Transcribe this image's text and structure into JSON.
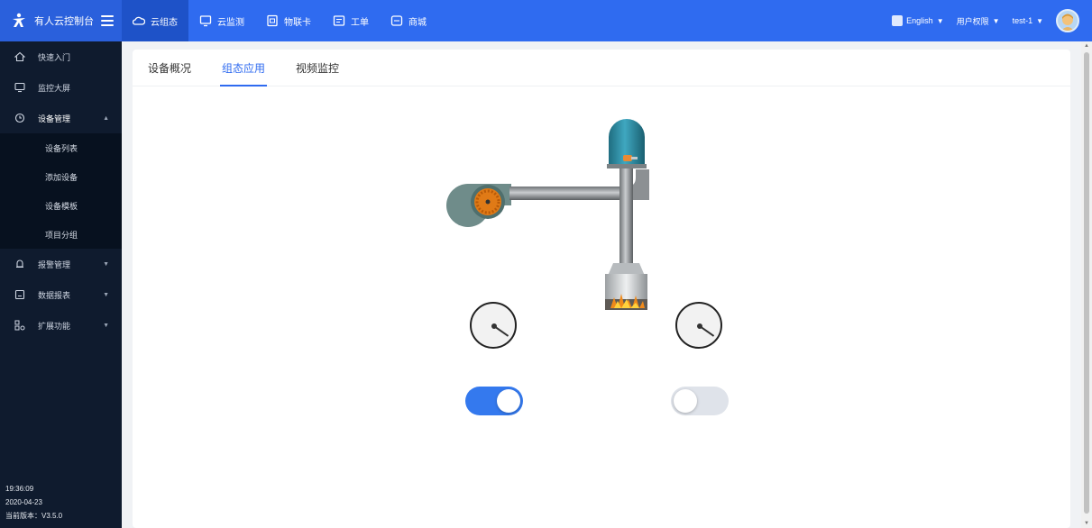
{
  "brand": {
    "title": "有人云控制台"
  },
  "nav": [
    {
      "label": "云组态",
      "icon": "cloud-icon",
      "active": true
    },
    {
      "label": "云监测",
      "icon": "monitor-icon",
      "active": false
    },
    {
      "label": "物联卡",
      "icon": "sim-card-icon",
      "active": false
    },
    {
      "label": "工单",
      "icon": "ticket-icon",
      "active": false
    },
    {
      "label": "商城",
      "icon": "shop-icon",
      "active": false
    }
  ],
  "topRight": {
    "language": "English",
    "permissions": "用户权限",
    "user": "test-1"
  },
  "sidebar": {
    "items": [
      {
        "label": "快速入门",
        "icon": "home-icon"
      },
      {
        "label": "监控大屏",
        "icon": "screen-icon"
      },
      {
        "label": "设备管理",
        "icon": "clock-icon"
      }
    ],
    "subItems": [
      "设备列表",
      "添加设备",
      "设备模板",
      "项目分组"
    ],
    "items2": [
      {
        "label": "报警管理",
        "icon": "bell-icon"
      },
      {
        "label": "数据报表",
        "icon": "report-icon"
      },
      {
        "label": "扩展功能",
        "icon": "extend-icon"
      }
    ],
    "footer": {
      "time": "19:36:09",
      "date": "2020-04-23",
      "version": "当前版本：V3.5.0"
    }
  },
  "tabs": [
    {
      "label": "设备概况",
      "active": false
    },
    {
      "label": "组态应用",
      "active": true
    },
    {
      "label": "视频监控",
      "active": false
    }
  ],
  "scada": {
    "gauges": [
      {
        "icon": "pressure-gauge-icon"
      },
      {
        "icon": "pressure-gauge-icon"
      }
    ],
    "switches": [
      {
        "state": "on"
      },
      {
        "state": "off"
      }
    ]
  },
  "colors": {
    "primary": "#2f6bf0",
    "sidebar": "#0f1b2e",
    "switchOn": "#3479ee",
    "switchOff": "#dfe3ea"
  }
}
